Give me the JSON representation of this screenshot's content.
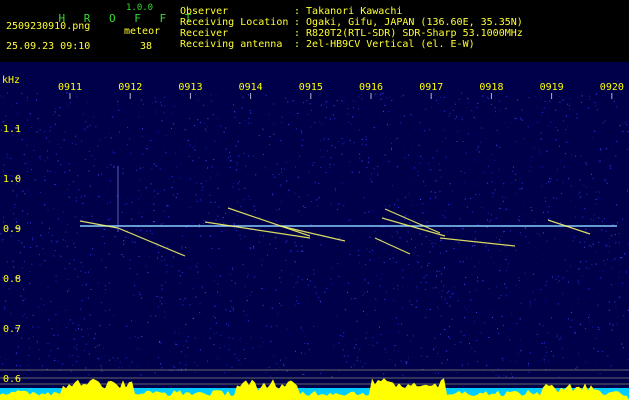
{
  "header": {
    "app_name": "H R O F F T",
    "version": "1.0.0",
    "filename": "2509230910.png",
    "datetime": "25.09.23 09:10",
    "meteor_label": "meteor",
    "meteor_count": "38",
    "info_labels": [
      "Observer",
      "Receiving Location",
      "Receiver",
      "Receiving antenna"
    ],
    "info_values": [
      ": Takanori Kawachi",
      ": Ogaki, Gifu, JAPAN (136.60E, 35.35N)",
      ": R820T2(RTL-SDR) SDR-Sharp 53.1000MHz",
      ": 2el-HB9CV Vertical (el. E-W)"
    ]
  },
  "spectrogram": {
    "unit_label": "kHz",
    "time_ticks": [
      "0911",
      "0912",
      "0913",
      "0914",
      "0915",
      "0916",
      "0917",
      "0918",
      "0919",
      "0920"
    ],
    "freq_ticks": [
      "1.1",
      "1.0",
      "0.9",
      "0.8",
      "0.7",
      "0.6"
    ],
    "colors": {
      "background": "#00004a",
      "carrier": "#88ccff",
      "meteor": "#ffff66",
      "level_fill": "#ffff00",
      "level_base": "#00ccff",
      "tick_text": "#ffff00"
    }
  }
}
